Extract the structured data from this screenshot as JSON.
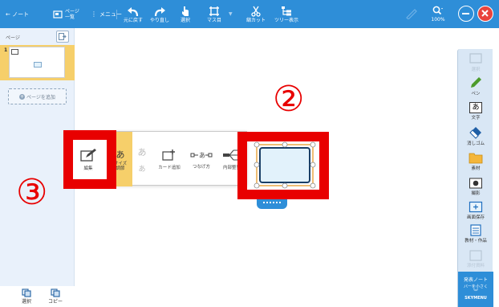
{
  "toolbar": {
    "back_label": "← ノート",
    "page_list_line1": "ページ",
    "page_list_line2": "一覧",
    "menu_label": "メニュー",
    "undo_label": "元に戻す",
    "redo_label": "やり直し",
    "select_label": "選択",
    "grid_label": "マス目",
    "slim_label": "縮カット",
    "tree_label": "ツリー表示",
    "zoom_label": "100%"
  },
  "left_panel": {
    "title": "ページ",
    "page_number": "1",
    "add_page": "ページを追加",
    "bottom_left": "選択",
    "bottom_right": "コピー"
  },
  "right_panel": {
    "tools": [
      {
        "label": "選択",
        "icon": "select-icon",
        "dim": true
      },
      {
        "label": "ペン",
        "icon": "pen-icon",
        "dim": false
      },
      {
        "label": "文字",
        "icon": "text-icon",
        "dim": false
      },
      {
        "label": "消しゴム",
        "icon": "eraser-icon",
        "dim": false
      },
      {
        "label": "素材",
        "icon": "folder-icon",
        "dim": false
      },
      {
        "label": "撮影",
        "icon": "camera-icon",
        "dim": false
      },
      {
        "label": "画面保存",
        "icon": "screenshot-icon",
        "dim": false
      },
      {
        "label": "教材・作品",
        "icon": "material-icon",
        "dim": false
      },
      {
        "label": "添付資料",
        "icon": "attachment-icon",
        "dim": true
      }
    ],
    "foot_line1": "発表ノート",
    "foot_line2": "バーを小さく",
    "foot_line3": "SKYMENU"
  },
  "popup": {
    "edit_label": "編集",
    "resize_line1": "サイズ",
    "resize_line2": "調節",
    "char_glyph": "あ",
    "add_card": "カード追加",
    "connect": "つなげ方",
    "internal": "内部整列"
  },
  "annotations": {
    "two": "②",
    "three": "③"
  },
  "colors": {
    "toolbar_blue": "#2e8ed8",
    "highlight_yellow": "#f6cf6a",
    "annotation_red": "#e80000",
    "close_red": "#e9433c"
  }
}
